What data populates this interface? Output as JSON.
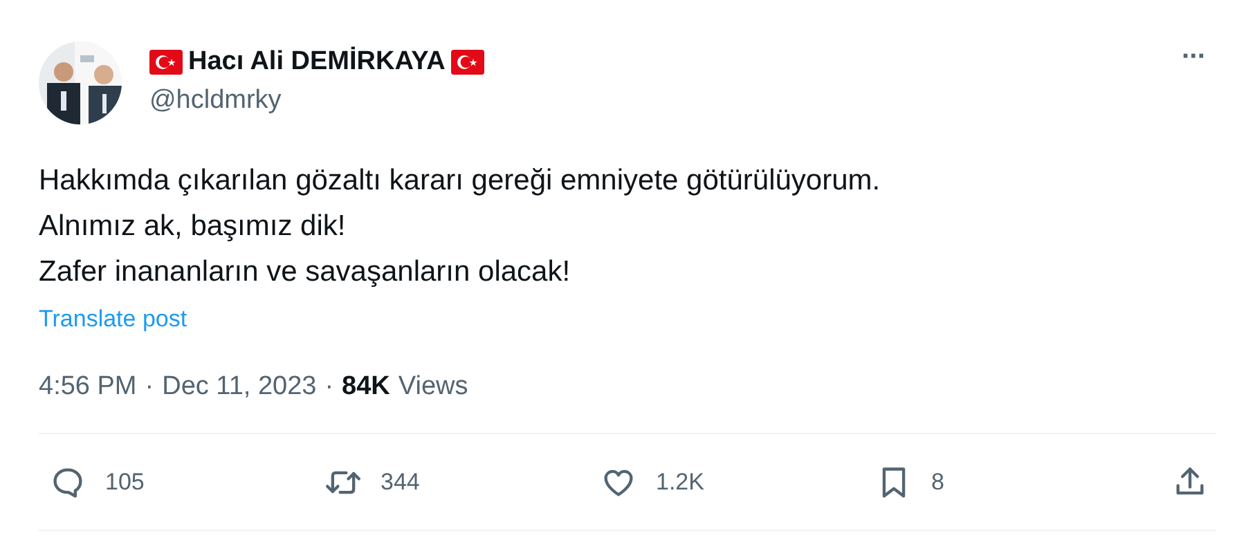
{
  "author": {
    "name": "Hacı Ali DEMİRKAYA",
    "handle": "@hcldmrky"
  },
  "more_button": "···",
  "body": [
    "Hakkımda çıkarılan gözaltı kararı gereği emniyete götürülüyorum.",
    "Alnımız ak, başımız dik!",
    "Zafer inananların ve savaşanların olacak!"
  ],
  "translate": "Translate post",
  "meta": [
    {
      "text": "4:56 PM",
      "bold": false
    },
    {
      "text": "·",
      "bold": false
    },
    {
      "text": "Dec 11, 2023",
      "bold": false
    },
    {
      "text": "·",
      "bold": false
    },
    {
      "text": "84K",
      "bold": true
    },
    {
      "text": "Views",
      "bold": false
    }
  ],
  "actions": [
    {
      "kind": "reply",
      "count": "105"
    },
    {
      "kind": "repost",
      "count": "344"
    },
    {
      "kind": "like",
      "count": "1.2K"
    },
    {
      "kind": "bookmark",
      "count": "8"
    },
    {
      "kind": "share"
    }
  ]
}
